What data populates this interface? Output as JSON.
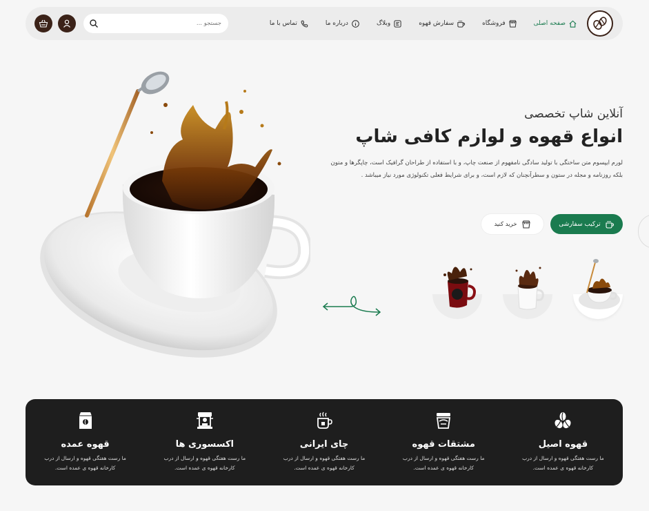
{
  "header": {
    "nav": [
      {
        "label": "صفحه اصلی",
        "icon": "home-icon",
        "active": true
      },
      {
        "label": "فروشگاه",
        "icon": "shop-icon",
        "active": false
      },
      {
        "label": "سفارش قهوه",
        "icon": "coffee-icon",
        "active": false
      },
      {
        "label": "وبلاگ",
        "icon": "blog-icon",
        "active": false
      },
      {
        "label": "درباره ما",
        "icon": "info-icon",
        "active": false
      },
      {
        "label": "تماس با ما",
        "icon": "phone-icon",
        "active": false
      }
    ],
    "search_placeholder": "جستجو ...",
    "cart_icon": "basket-icon",
    "user_icon": "user-icon"
  },
  "hero": {
    "subtitle": "آنلاین شاپ تخصصی",
    "title": "انواع قهوه و لوازم کافی شاپ",
    "description": "لورم ایپسوم متن ساختگی با تولید سادگی نامفهوم از صنعت چاپ، و با استفاده از طراحان گرافیک است، چاپگرها و متون بلکه روزنامه و مجله در ستون و سطرآنچنان که لازم است، و برای شرایط فعلی تکنولوژی مورد نیاز میباشد .",
    "primary_button": "ترکیب سفارشی",
    "secondary_button": "خرید کنید"
  },
  "features": [
    {
      "title": "قهوه اصیل",
      "desc": "ما رست هفتگی قهوه و ارسال از درب کارخانه قهوه ی عمده است.",
      "icon": "coffee-beans-icon"
    },
    {
      "title": "مشتقات قهوه",
      "desc": "ما رست هفتگی قهوه و ارسال از درب کارخانه قهوه ی عمده است.",
      "icon": "latte-cup-icon"
    },
    {
      "title": "چای ایرانی",
      "desc": "ما رست هفتگی قهوه و ارسال از درب کارخانه قهوه ی عمده است.",
      "icon": "tea-cup-icon"
    },
    {
      "title": "اکسسوری ها",
      "desc": "ما رست هفتگی قهوه و ارسال از درب کارخانه قهوه ی عمده است.",
      "icon": "coffee-machine-icon"
    },
    {
      "title": "قهوه عمده",
      "desc": "ما رست هفتگی قهوه و ارسال از درب کارخانه قهوه ی عمده است.",
      "icon": "coffee-bag-icon"
    }
  ],
  "colors": {
    "brand_green": "#1a7b4f",
    "brand_brown": "#3b2218",
    "dark_panel": "#1e1e1e"
  }
}
